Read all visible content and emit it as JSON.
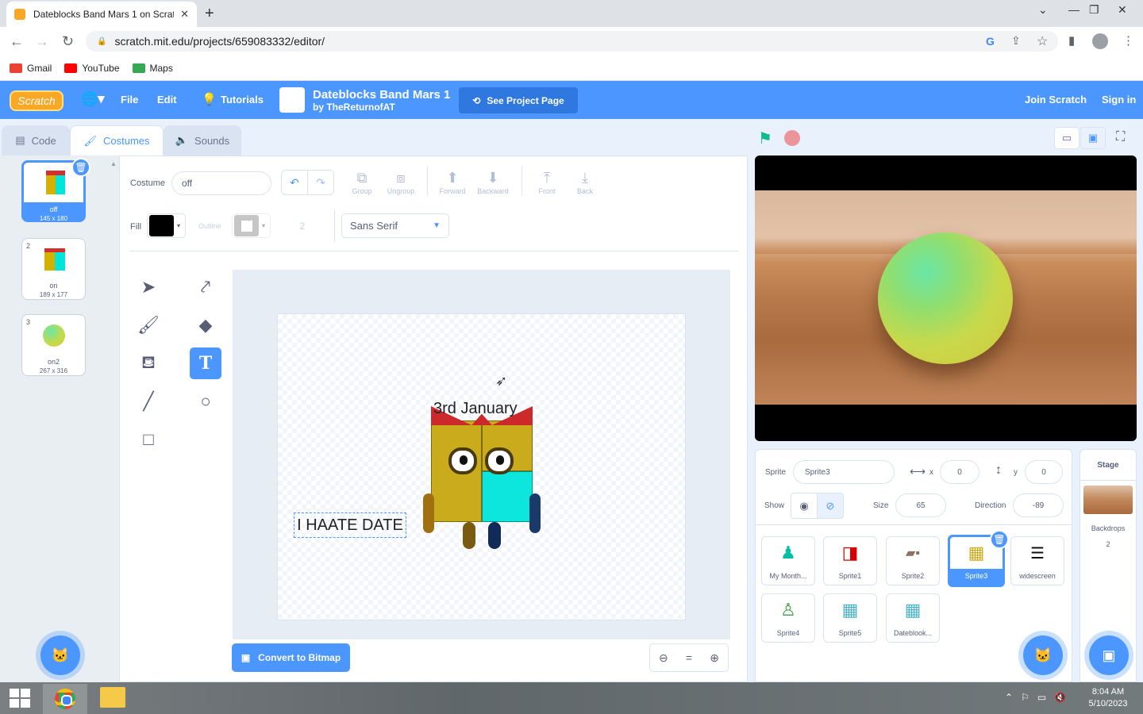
{
  "browser": {
    "tab_title": "Dateblocks Band Mars 1 on Scratch",
    "url": "scratch.mit.edu/projects/659083332/editor/",
    "bookmarks": [
      "Gmail",
      "YouTube",
      "Maps"
    ]
  },
  "menu": {
    "file": "File",
    "edit": "Edit",
    "tutorials": "Tutorials",
    "project_title": "Dateblocks Band Mars 1",
    "project_author": "by TheReturnofAT",
    "see_project": "See Project Page",
    "join": "Join Scratch",
    "signin": "Sign in"
  },
  "tabs": {
    "code": "Code",
    "costumes": "Costumes",
    "sounds": "Sounds"
  },
  "costumes": [
    {
      "num": "1",
      "name": "off",
      "size": "145 x 180"
    },
    {
      "num": "2",
      "name": "on",
      "size": "189 x 177"
    },
    {
      "num": "3",
      "name": "on2",
      "size": "267 x 316"
    }
  ],
  "paint": {
    "costume_label": "Costume",
    "costume_name": "off",
    "group": "Group",
    "ungroup": "Ungroup",
    "forward": "Forward",
    "backward": "Backward",
    "front": "Front",
    "back": "Back",
    "fill_label": "Fill",
    "fill_color": "#000000",
    "outline_label": "Outline",
    "stroke_width": "2",
    "font": "Sans Serif",
    "text_date": "3rd January",
    "text_haate": "I HAATE DATE",
    "convert_bitmap": "Convert to Bitmap"
  },
  "sprite_info": {
    "sprite_label": "Sprite",
    "sprite_name": "Sprite3",
    "x_label": "x",
    "x": "0",
    "y_label": "y",
    "y": "0",
    "show_label": "Show",
    "size_label": "Size",
    "size": "65",
    "direction_label": "Direction",
    "direction": "-89"
  },
  "sprites": [
    "My Month...",
    "Sprite1",
    "Sprite2",
    "Sprite3",
    "widescreen",
    "Sprite4",
    "Sprite5",
    "Dateblook..."
  ],
  "stage_panel": {
    "title": "Stage",
    "backdrops_label": "Backdrops",
    "backdrops_count": "2"
  },
  "taskbar": {
    "time": "8:04 AM",
    "date": "5/10/2023"
  },
  "colors": {
    "scratch_blue": "#4c97ff",
    "green_flag": "#0fbd8c",
    "stop": "#ec5959"
  }
}
